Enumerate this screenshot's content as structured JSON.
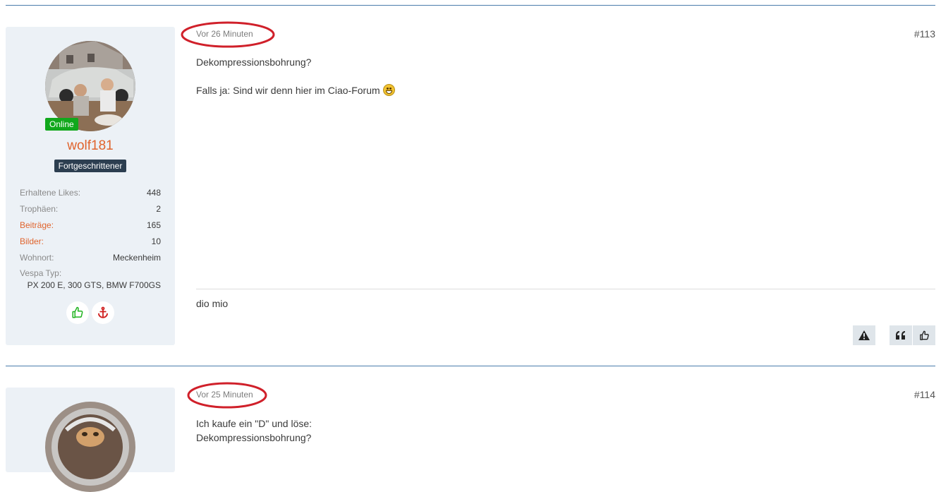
{
  "colors": {
    "divider": "#4a7cab",
    "sidebar_bg": "#ecf1f6",
    "username": "#e0642d",
    "online_badge": "#11a81c",
    "rank_badge": "#2c3e50",
    "highlight_ellipse": "#d0202a"
  },
  "posts": [
    {
      "time": "Vor 26 Minuten",
      "number": "#113",
      "user": {
        "online_label": "Online",
        "name": "wolf181",
        "rank": "Fortgeschrittener",
        "stats": [
          {
            "label": "Erhaltene Likes:",
            "value": "448"
          },
          {
            "label": "Trophäen:",
            "value": "2"
          },
          {
            "label": "Beiträge:",
            "value": "165"
          },
          {
            "label": "Bilder:",
            "value": "10"
          },
          {
            "label": "Wohnort:",
            "value": "Meckenheim"
          },
          {
            "label": "Vespa Typ:",
            "value": "PX 200 E, 300 GTS, BMW F700GS"
          }
        ],
        "icons": [
          "thumbs-up-icon",
          "anchor-icon"
        ]
      },
      "lines": [
        "Dekompressionsbohrung?",
        "Falls ja: Sind wir denn hier im Ciao-Forum"
      ],
      "emoji": "grinning-emoji",
      "signature": "dio mio",
      "actions": [
        "warning-icon",
        "quote-icon",
        "like-icon"
      ]
    },
    {
      "time": "Vor 25 Minuten",
      "number": "#114",
      "lines": [
        "Ich kaufe ein \"D\" und löse:",
        "Dekompressionsbohrung?"
      ]
    }
  ]
}
